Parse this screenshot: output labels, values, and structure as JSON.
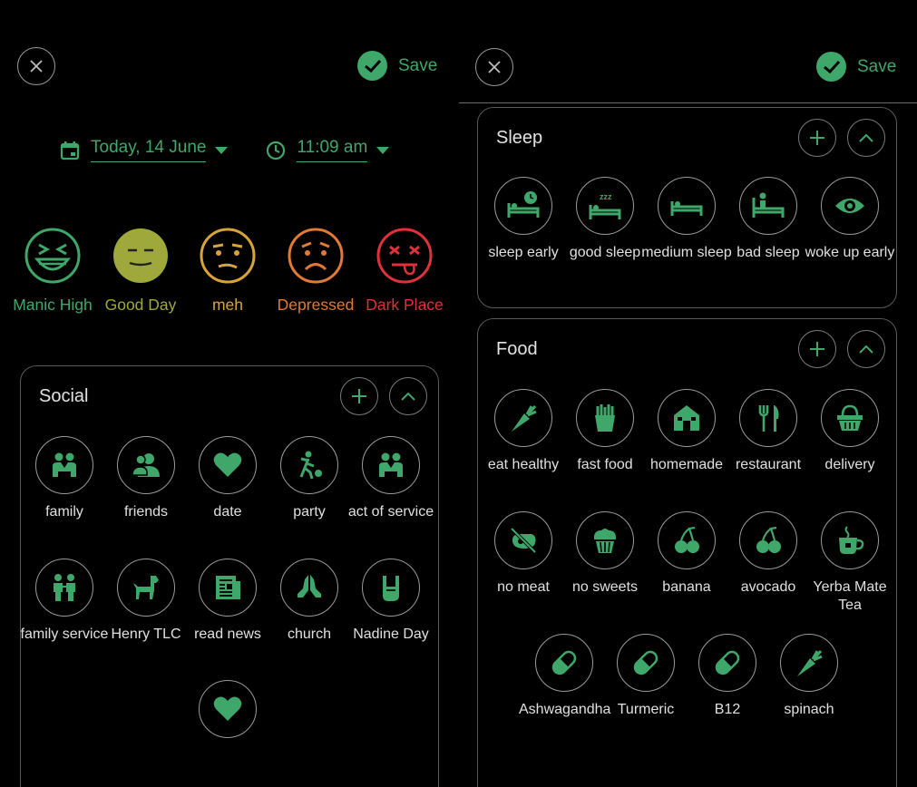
{
  "left": {
    "header": {
      "save_label": "Save"
    },
    "date_label": "Today, 14 June",
    "time_label": "11:09 am",
    "moods": [
      {
        "label": "Manic High",
        "color": "#3fa76a",
        "icon": "laughing-face-icon"
      },
      {
        "label": "Good Day",
        "color": "#9fa83a",
        "icon": "content-face-icon"
      },
      {
        "label": "meh",
        "color": "#d9a33a",
        "icon": "meh-face-icon"
      },
      {
        "label": "Depressed",
        "color": "#e07a34",
        "icon": "sad-face-icon"
      },
      {
        "label": "Dark Place",
        "color": "#e0313a",
        "icon": "dead-face-icon"
      }
    ],
    "social": {
      "title": "Social",
      "items": [
        {
          "label": "family",
          "icon": "family-icon"
        },
        {
          "label": "friends",
          "icon": "friends-icon"
        },
        {
          "label": "date",
          "icon": "heart-icon"
        },
        {
          "label": "party",
          "icon": "party-icon"
        },
        {
          "label": "act of service",
          "icon": "family-icon"
        },
        {
          "label": "family service",
          "icon": "family-service-icon"
        },
        {
          "label": "Henry TLC",
          "icon": "dog-icon"
        },
        {
          "label": "read news",
          "icon": "newspaper-icon"
        },
        {
          "label": "church",
          "icon": "praying-hands-icon"
        },
        {
          "label": "Nadine Day",
          "icon": "rock-hand-icon"
        },
        {
          "label": "",
          "icon": "heart-icon"
        }
      ]
    }
  },
  "right": {
    "header": {
      "save_label": "Save"
    },
    "sleep": {
      "title": "Sleep",
      "items": [
        {
          "label": "sleep early",
          "icon": "bed-clock-icon"
        },
        {
          "label": "good sleep",
          "icon": "bed-zzz-icon"
        },
        {
          "label": "medium sleep",
          "icon": "bed-icon"
        },
        {
          "label": "bad sleep",
          "icon": "sitting-bed-icon"
        },
        {
          "label": "woke up early",
          "icon": "eye-icon"
        }
      ]
    },
    "food": {
      "title": "Food",
      "items": [
        {
          "label": "eat healthy",
          "icon": "carrot-icon"
        },
        {
          "label": "fast food",
          "icon": "fries-icon"
        },
        {
          "label": "homemade",
          "icon": "house-icon"
        },
        {
          "label": "restaurant",
          "icon": "fork-knife-icon"
        },
        {
          "label": "delivery",
          "icon": "delivery-basket-icon"
        },
        {
          "label": "no meat",
          "icon": "no-meat-icon"
        },
        {
          "label": "no sweets",
          "icon": "muffin-icon"
        },
        {
          "label": "banana",
          "icon": "cherries-icon"
        },
        {
          "label": "avocado",
          "icon": "cherries-icon"
        },
        {
          "label": "Yerba Mate Tea",
          "icon": "tea-cup-icon"
        },
        {
          "label": "Ashwagandha",
          "icon": "pill-icon"
        },
        {
          "label": "Turmeric",
          "icon": "pill-icon"
        },
        {
          "label": "B12",
          "icon": "pill-icon"
        },
        {
          "label": "spinach",
          "icon": "carrot-icon"
        }
      ]
    }
  }
}
